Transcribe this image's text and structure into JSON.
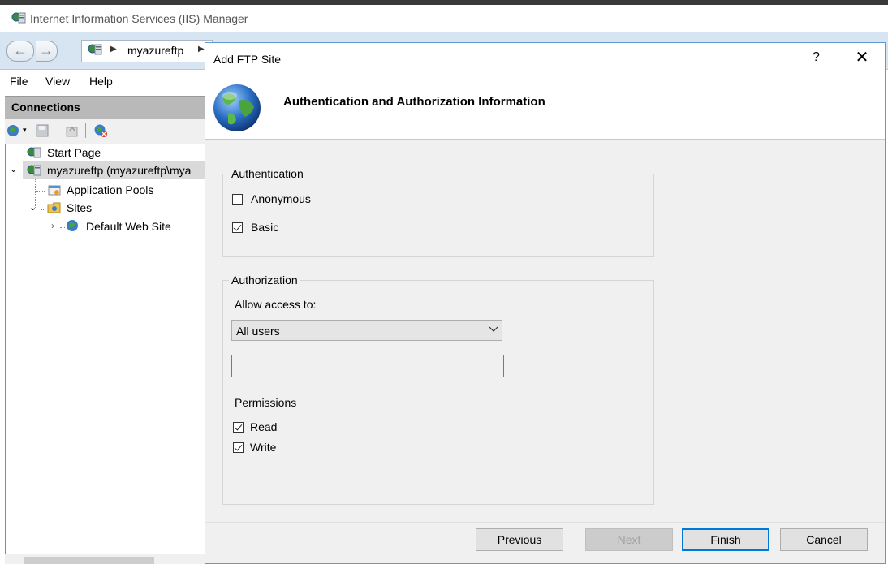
{
  "iis": {
    "window_title": "Internet Information Services (IIS) Manager",
    "address_text": "myazureftp",
    "menu": {
      "file": "File",
      "view": "View",
      "help": "Help"
    },
    "connections_title": "Connections",
    "tree": {
      "start_page": "Start Page",
      "server": "myazureftp (myazureftp\\mya",
      "app_pools": "Application Pools",
      "sites": "Sites",
      "default_site": "Default Web Site"
    }
  },
  "dialog": {
    "title": "Add FTP Site",
    "help_glyph": "?",
    "close_glyph": "✕",
    "header_title": "Authentication and Authorization Information",
    "authentication": {
      "group_title": "Authentication",
      "anonymous": {
        "label": "Anonymous",
        "checked": false
      },
      "basic": {
        "label": "Basic",
        "checked": true
      }
    },
    "authorization": {
      "group_title": "Authorization",
      "allow_access_label": "Allow access to:",
      "allow_access_value": "All users",
      "user_textbox_value": "",
      "permissions_label": "Permissions",
      "read": {
        "label": "Read",
        "checked": true
      },
      "write": {
        "label": "Write",
        "checked": true
      }
    },
    "buttons": {
      "previous": "Previous",
      "next": "Next",
      "finish": "Finish",
      "cancel": "Cancel"
    }
  },
  "colors": {
    "dialog_border": "#5a9bd5",
    "default_button_border": "#0078d7",
    "address_bar": "#d7e5f3"
  }
}
